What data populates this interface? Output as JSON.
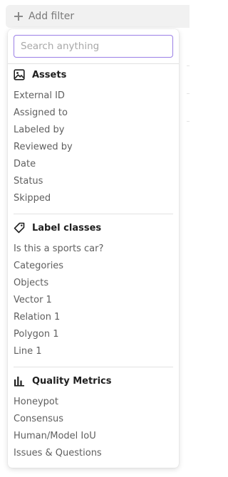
{
  "add_filter": {
    "label": "Add filter"
  },
  "search": {
    "placeholder": "Search anything",
    "value": ""
  },
  "sections": [
    {
      "title": "Assets",
      "icon": "image-icon",
      "items": [
        "External ID",
        "Assigned to",
        "Labeled by",
        "Reviewed by",
        "Date",
        "Status",
        "Skipped"
      ]
    },
    {
      "title": "Label classes",
      "icon": "tag-icon",
      "items": [
        "Is this a sports car?",
        "Categories",
        "Objects",
        "Vector 1",
        "Relation 1",
        "Polygon 1",
        "Line 1"
      ]
    },
    {
      "title": "Quality Metrics",
      "icon": "bar-chart-icon",
      "items": [
        "Honeypot",
        "Consensus",
        "Human/Model IoU",
        "Issues & Questions"
      ]
    }
  ],
  "colors": {
    "accent": "#9b7fe6",
    "item_text": "#5f5f5f",
    "header_text": "#1f1f1f"
  }
}
